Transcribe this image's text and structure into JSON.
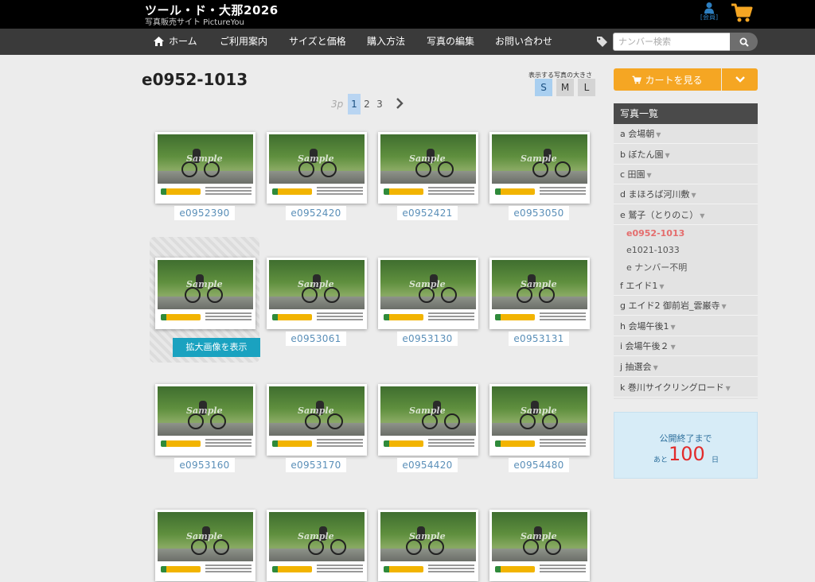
{
  "header": {
    "title": "ツール・ド・大那2026",
    "subtitle": "写真販売サイト PictureYou",
    "member_label": "[会員]"
  },
  "nav": {
    "home": "ホーム",
    "guide": "ご利用案内",
    "sizes": "サイズと価格",
    "purchase": "購入方法",
    "edit": "写真の編集",
    "contact": "お問い合わせ"
  },
  "search": {
    "placeholder": "ナンバー検索"
  },
  "page": {
    "title": "e0952-1013"
  },
  "size_selector": {
    "label": "表示する写真の大きさ",
    "options": [
      "S",
      "M",
      "L"
    ],
    "selected": "S"
  },
  "pager": {
    "prev": "3p",
    "pages": [
      "1",
      "2",
      "3"
    ],
    "current": "1"
  },
  "photos": [
    "e0952390",
    "e0952420",
    "e0952421",
    "e0953050",
    "",
    "e0953061",
    "e0953130",
    "e0953131",
    "e0953160",
    "e0953170",
    "e0954420",
    "e0954480",
    "",
    "",
    "",
    ""
  ],
  "photo_watermark": "Sample",
  "zoom_button": "拡大画像を表示",
  "sidebar": {
    "cart_button": "カートを見る",
    "list_title": "写真一覧",
    "items": [
      "a 会場朝",
      "b ぼたん園",
      "c 田園",
      "d まほろば河川敷",
      "e 鷲子（とりのこ）",
      "f エイド1",
      "g エイド2 御前岩_雲巌寺",
      "h 会場午後1",
      "i 会場午後２",
      "j 抽選会",
      "k 巻川サイクリングロード"
    ],
    "sub_items": [
      "e0952-1013",
      "e1021-1033",
      "e ナンバー不明"
    ],
    "active_sub": "e0952-1013"
  },
  "countdown": {
    "label": "公開終了まで",
    "prefix": "あと",
    "days": "100",
    "unit": "日"
  },
  "colors": {
    "accent_orange": "#f5a623",
    "link_blue": "#5a8fb8",
    "active_red": "#e46d6d",
    "count_red": "#e22b2b"
  }
}
